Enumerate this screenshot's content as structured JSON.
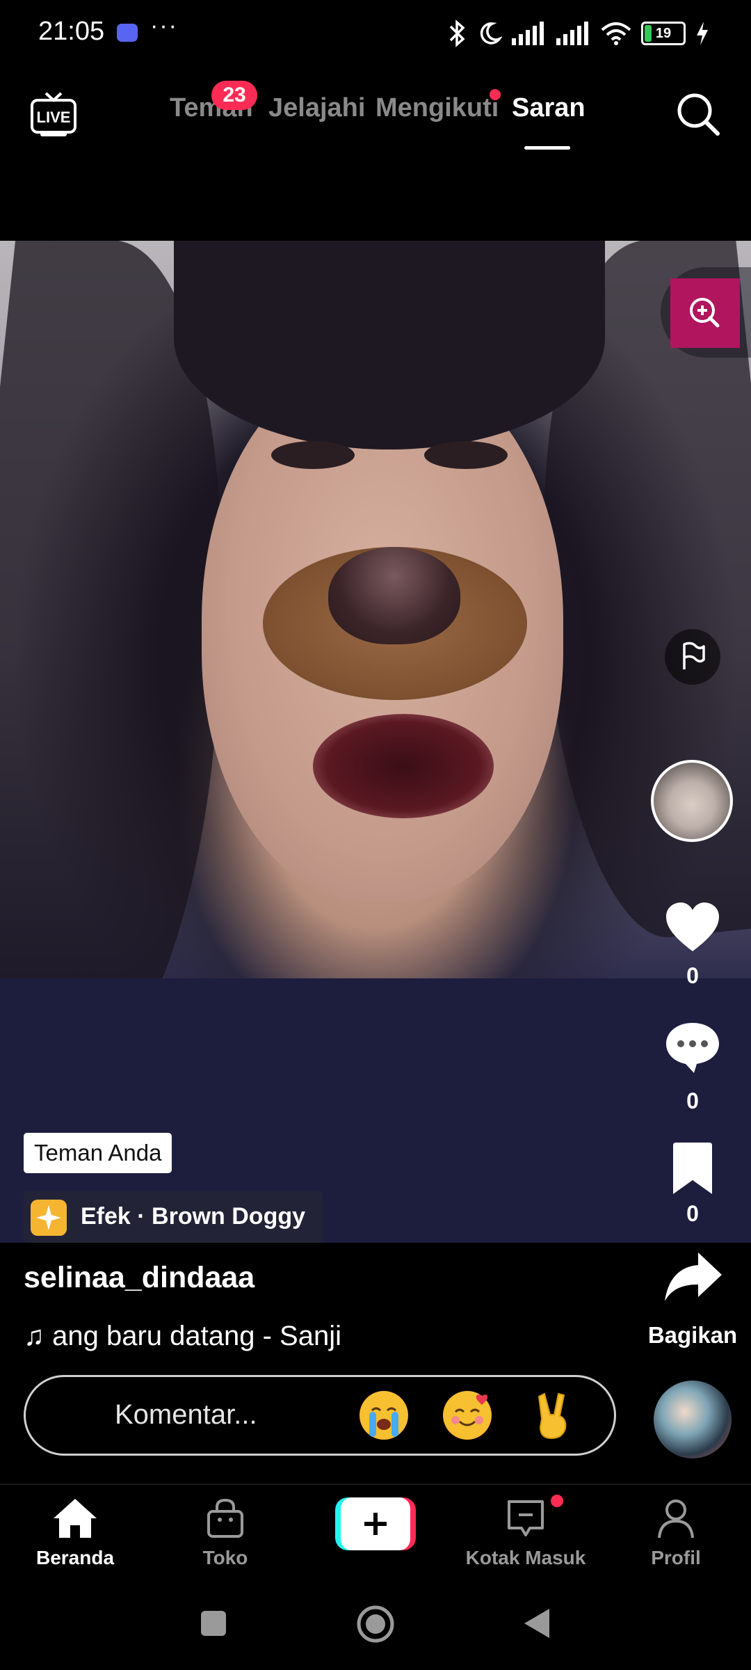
{
  "status_bar": {
    "time": "21:05",
    "more": "···",
    "battery": "19",
    "icons": [
      "discord-icon",
      "bluetooth-icon",
      "moon-icon",
      "signal-icon",
      "signal-icon",
      "wifi-icon",
      "battery-icon",
      "charging-icon"
    ]
  },
  "top_nav": {
    "tabs": [
      {
        "label": "Teman",
        "badge": "23"
      },
      {
        "label": "Jelajahi"
      },
      {
        "label": "Mengikuti",
        "dot": true
      },
      {
        "label": "Saran",
        "active": true
      }
    ],
    "live_label": "LIVE"
  },
  "video": {
    "friend_tag": "Teman Anda",
    "effect": "Efek · Brown Doggy",
    "username": "selinaa_dindaaa",
    "music": "ang baru datang - Sanji",
    "music_icon": "♫"
  },
  "side_actions": {
    "likes": "0",
    "comments": "0",
    "saves": "0",
    "share_label": "Bagikan"
  },
  "comment_bar": {
    "placeholder": "Komentar...",
    "emojis": [
      "😭",
      "🥰",
      "✌️"
    ]
  },
  "bottom_nav": {
    "items": [
      {
        "label": "Beranda",
        "active": true
      },
      {
        "label": "Toko"
      },
      {
        "label": ""
      },
      {
        "label": "Kotak Masuk",
        "dot": true
      },
      {
        "label": "Profil"
      }
    ]
  },
  "colors": {
    "accent": "#fe2c55",
    "create_left": "#25f4ee",
    "create_right": "#fe2c55",
    "effect_icon": "#f6b531",
    "zoom_button": "#b0155e"
  }
}
